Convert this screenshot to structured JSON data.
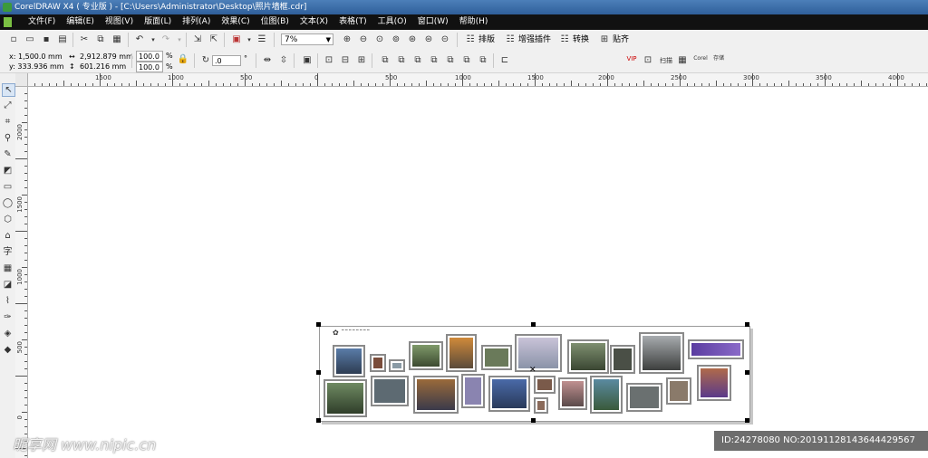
{
  "window": {
    "title": "CorelDRAW X4 ( 专业版 ) - [C:\\Users\\Administrator\\Desktop\\照片墙框.cdr]"
  },
  "menu": [
    "文件(F)",
    "编辑(E)",
    "视图(V)",
    "版面(L)",
    "排列(A)",
    "效果(C)",
    "位图(B)",
    "文本(X)",
    "表格(T)",
    "工具(O)",
    "窗口(W)",
    "帮助(H)"
  ],
  "toolbar": {
    "zoom_value": "7%",
    "plugin_labels": [
      "排版",
      "增强插件",
      "转换",
      "贴齐"
    ]
  },
  "property_bar": {
    "x": "x: 1,500.0 mm",
    "y": "y: 333.936 mm",
    "width": "2,912.879 mm",
    "height": "601.216 mm",
    "scale_x": "100.0",
    "scale_y": "100.0",
    "pct": "%",
    "rotation": ".0",
    "degree": "°",
    "right_icons": [
      "VIP",
      "扫描",
      "Corel",
      "存储"
    ]
  },
  "ruler": {
    "h_labels": [
      "1500",
      "1000",
      "500",
      "0",
      "500",
      "1000",
      "1500",
      "2000",
      "2500",
      "3000",
      "3500",
      "4000"
    ],
    "v_labels": [
      "2000",
      "1500",
      "1000",
      "500",
      "0"
    ]
  },
  "tools": [
    "pick-tool",
    "shape-tool",
    "crop-tool",
    "zoom-tool",
    "freehand-tool",
    "smart-fill-tool",
    "rectangle-tool",
    "ellipse-tool",
    "polygon-tool",
    "basic-shapes-tool",
    "text-tool",
    "table-tool",
    "interactive-tool",
    "eyedropper-tool",
    "outline-tool",
    "fill-tool",
    "interactive-fill-tool"
  ],
  "text_tool_label": "字",
  "watermark": {
    "logo_text": "昵享网 www.nipic.cn",
    "id_text": "ID:24278080 NO:20191128143644429567"
  },
  "colors": {
    "title_bar": "#3b6ea8",
    "menu_bar": "#111111",
    "toolbar": "#f0f0f0"
  }
}
